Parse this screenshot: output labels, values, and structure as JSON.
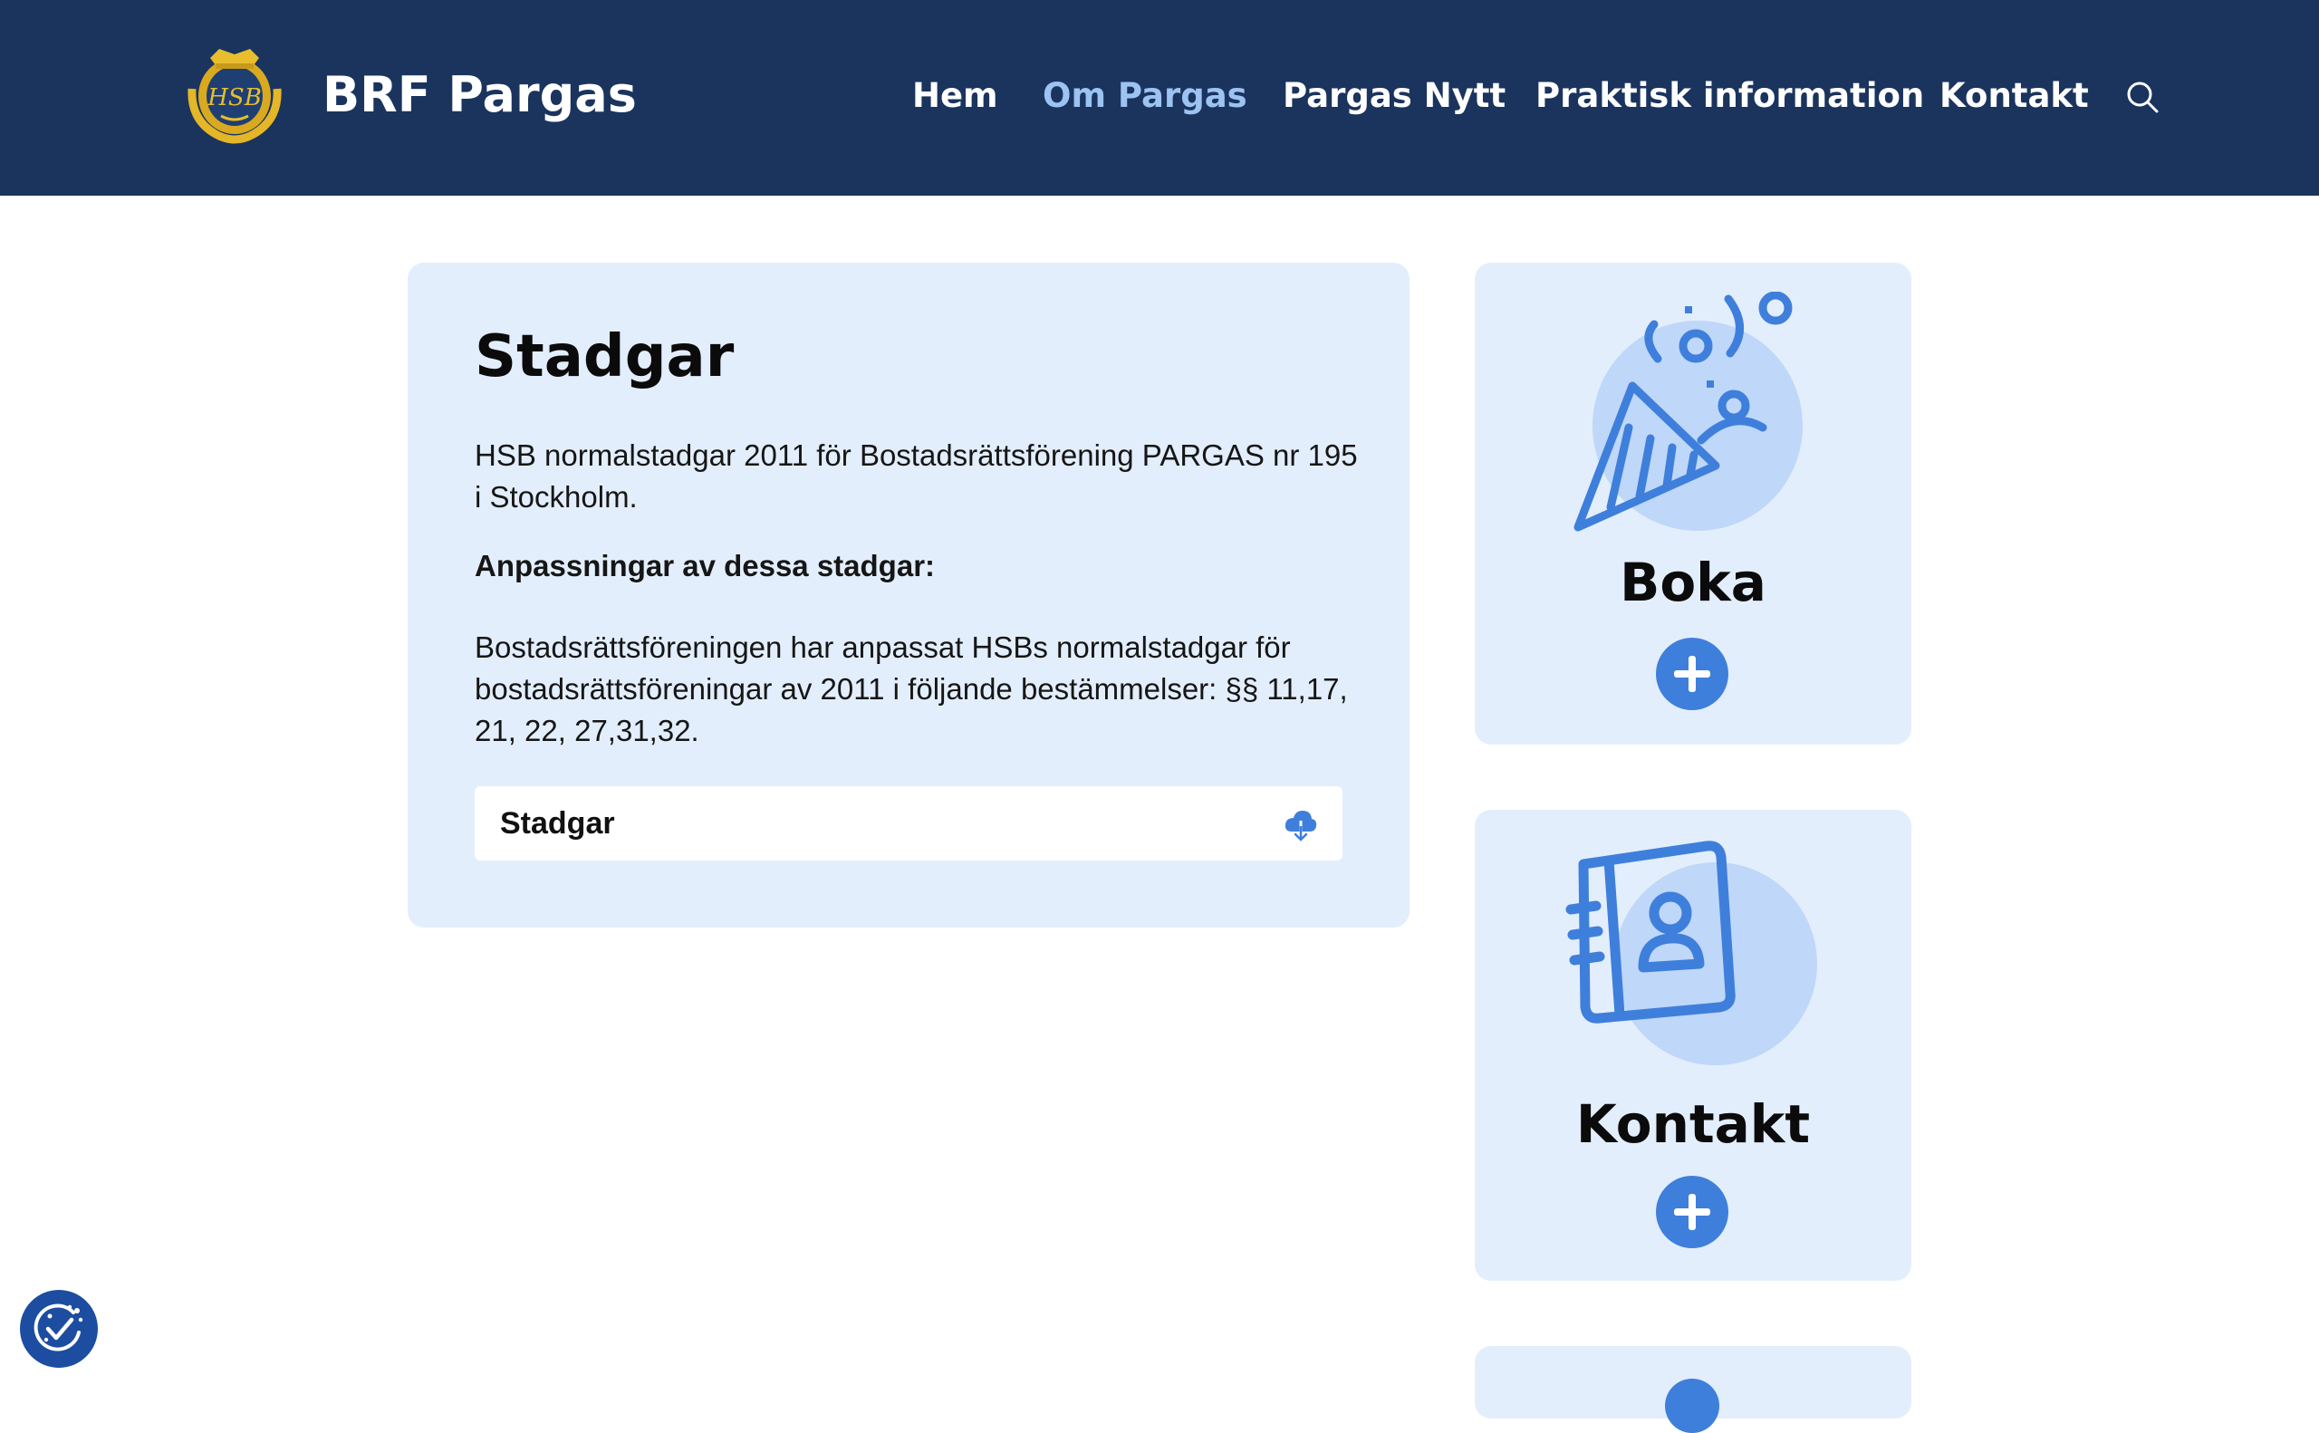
{
  "header": {
    "site_title": "BRF Pargas",
    "logo_icon": "hsb-logo-icon",
    "nav": [
      {
        "label": "Hem",
        "active": false
      },
      {
        "label": "Om Pargas",
        "active": true
      },
      {
        "label": "Pargas Nytt",
        "active": false
      },
      {
        "label": "Praktisk information",
        "active": false
      },
      {
        "label": "Kontakt",
        "active": false
      }
    ],
    "search_icon": "search-icon"
  },
  "main": {
    "title": "Stadgar",
    "intro": "HSB normalstadgar 2011 för Bostadsrättsförening PARGAS nr 195 i Stockholm.",
    "subheading": "Anpassningar av dessa stadgar:",
    "body": "Bostadsrättsföreningen har anpassat HSBs normalstadgar för bostadsrättsföreningar av 2011 i följande bestämmelser: §§ 11,17, 21, 22, 27,31,32.",
    "attachment": {
      "label": "Stadgar",
      "icon": "cloud-download-icon"
    }
  },
  "sidebar": {
    "cards": [
      {
        "title": "Boka",
        "icon": "party-popper-icon",
        "action_icon": "plus-icon"
      },
      {
        "title": "Kontakt",
        "icon": "address-book-icon",
        "action_icon": "plus-icon"
      }
    ]
  },
  "cookie_button": {
    "icon": "cookie-settings-icon"
  },
  "colors": {
    "header_bg": "#1a345e",
    "nav_active": "#9cc3f1",
    "card_bg": "#e3eefc",
    "accent": "#3f7fdc"
  }
}
